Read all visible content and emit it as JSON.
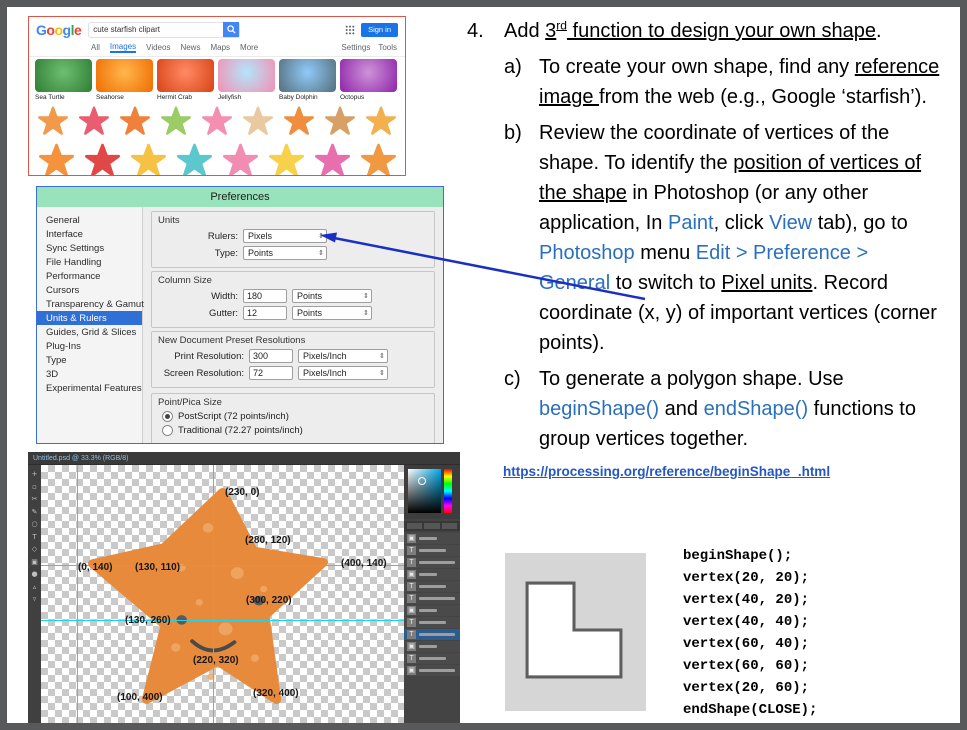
{
  "google": {
    "logo_letters": [
      {
        "ch": "G",
        "color": "#4285F4"
      },
      {
        "ch": "o",
        "color": "#EA4335"
      },
      {
        "ch": "o",
        "color": "#FBBC05"
      },
      {
        "ch": "g",
        "color": "#4285F4"
      },
      {
        "ch": "l",
        "color": "#34A853"
      },
      {
        "ch": "e",
        "color": "#EA4335"
      }
    ],
    "query": "cute starfish clipart",
    "signin": "Sign in",
    "tabs": [
      "All",
      "Images",
      "Videos",
      "News",
      "Maps",
      "More"
    ],
    "right_tabs": [
      "Settings",
      "Tools"
    ],
    "related": [
      {
        "label": "Sea Turtle",
        "colors": [
          "#6fbf73",
          "#2e7d32"
        ]
      },
      {
        "label": "Seahorse",
        "colors": [
          "#ffb74d",
          "#ef6c00"
        ]
      },
      {
        "label": "Hermit Crab",
        "colors": [
          "#ff8a65",
          "#d84315"
        ]
      },
      {
        "label": "Jellyfish",
        "colors": [
          "#b3e5fc",
          "#f48fb1"
        ]
      },
      {
        "label": "Baby Dolphin",
        "colors": [
          "#90caf9",
          "#546e7a"
        ]
      },
      {
        "label": "Octopus",
        "colors": [
          "#ce93d8",
          "#8e24aa"
        ]
      }
    ],
    "star_rows": [
      [
        "#f2994a",
        "#e85d6f",
        "#ef813c",
        "#9ccc65",
        "#f48fb1",
        "#e8c9a0",
        "#ef8e3e",
        "#d9a066",
        "#f2b04e"
      ],
      [
        "#f5923e",
        "#e04848",
        "#f6c244",
        "#5bc8ce",
        "#f08db0",
        "#f7d14b",
        "#e86fae",
        "#ef9a42"
      ]
    ]
  },
  "prefs": {
    "title": "Preferences",
    "sidebar": [
      "General",
      "Interface",
      "Sync Settings",
      "File Handling",
      "Performance",
      "Cursors",
      "Transparency & Gamut",
      "Units & Rulers",
      "Guides, Grid & Slices",
      "Plug-Ins",
      "Type",
      "3D",
      "Experimental Features"
    ],
    "active_index": 7,
    "units": {
      "title": "Units",
      "rulers_label": "Rulers:",
      "rulers_value": "Pixels",
      "type_label": "Type:",
      "type_value": "Points"
    },
    "column": {
      "title": "Column Size",
      "width_label": "Width:",
      "width_value": "180",
      "width_unit": "Points",
      "gutter_label": "Gutter:",
      "gutter_value": "12",
      "gutter_unit": "Points"
    },
    "resolutions": {
      "title": "New Document Preset Resolutions",
      "print_label": "Print Resolution:",
      "print_value": "300",
      "print_unit": "Pixels/Inch",
      "screen_label": "Screen Resolution:",
      "screen_value": "72",
      "screen_unit": "Pixels/Inch"
    },
    "pointpica": {
      "title": "Point/Pica Size",
      "options": [
        {
          "label": "PostScript (72 points/inch)",
          "selected": true
        },
        {
          "label": "Traditional (72.27 points/inch)",
          "selected": false
        }
      ]
    }
  },
  "ps": {
    "title": "Untitled.psd @ 33.3% (RGB/8)",
    "coords": [
      "(230, 0)",
      "(0, 140)",
      "(130, 110)",
      "(280, 120)",
      "(400, 140)",
      "(300, 220)",
      "(130, 260)",
      "(220, 320)",
      "(100, 400)",
      "(320, 400)"
    ],
    "starfish_color": "#e78a3c",
    "tools": [
      {
        "name": "move-tool",
        "glyph": "+"
      },
      {
        "name": "marquee-tool",
        "glyph": "▫"
      },
      {
        "name": "lasso-tool",
        "glyph": "✂"
      },
      {
        "name": "pen-tool",
        "glyph": "✎"
      },
      {
        "name": "eyedropper-tool",
        "glyph": "○"
      },
      {
        "name": "type-tool",
        "glyph": "T"
      },
      {
        "name": "shape-tool",
        "glyph": "◇"
      },
      {
        "name": "crop-tool",
        "glyph": "▣"
      },
      {
        "name": "brush-tool",
        "glyph": "●"
      },
      {
        "name": "zoom-in-tool",
        "glyph": "▵"
      },
      {
        "name": "zoom-out-tool",
        "glyph": "▿"
      }
    ],
    "layers": [
      {
        "icon": "▣"
      },
      {
        "icon": "T"
      },
      {
        "icon": "T"
      },
      {
        "icon": "▣"
      },
      {
        "icon": "T"
      },
      {
        "icon": "T"
      },
      {
        "icon": "▣"
      },
      {
        "icon": "T"
      },
      {
        "icon": "T",
        "selected": true
      },
      {
        "icon": "▣"
      },
      {
        "icon": "T"
      },
      {
        "icon": "▣"
      }
    ]
  },
  "content": {
    "number": "4.",
    "heading": [
      {
        "t": "Add "
      },
      {
        "t": "3",
        "c": "u"
      },
      {
        "t": "rd",
        "c": "u sup"
      },
      {
        "t": " function to design your own shape",
        "c": "u"
      },
      {
        "t": "."
      }
    ],
    "items": [
      {
        "letter": "a)",
        "segments": [
          {
            "t": "To create your own shape, find any "
          },
          {
            "t": "reference image ",
            "c": "u"
          },
          {
            "t": "from the web (e.g., Google ‘starfish’)."
          }
        ]
      },
      {
        "letter": "b)",
        "segments": [
          {
            "t": "Review the coordinate of vertices of the shape. To identify the "
          },
          {
            "t": "position of vertices of the shape",
            "c": "u"
          },
          {
            "t": " in Photoshop (or any other application, In "
          },
          {
            "t": "Paint",
            "c": "b"
          },
          {
            "t": ", click "
          },
          {
            "t": "View",
            "c": "b"
          },
          {
            "t": " tab), go to "
          },
          {
            "t": "Photoshop",
            "c": "b"
          },
          {
            "t": " menu "
          },
          {
            "t": "Edit > Preference > General",
            "c": "b"
          },
          {
            "t": " to switch to "
          },
          {
            "t": "Pixel units",
            "c": "u"
          },
          {
            "t": ".  Record coordinate (x, y) of important vertices (corner points)."
          }
        ]
      },
      {
        "letter": "c)",
        "segments": [
          {
            "t": "To generate a polygon shape. Use "
          },
          {
            "t": "beginShape()",
            "c": "b"
          },
          {
            "t": " and "
          },
          {
            "t": "endShape()",
            "c": "b"
          },
          {
            "t": " functions to group vertices together."
          }
        ]
      }
    ],
    "link": "https://processing.org/reference/beginShape_.html",
    "code": [
      "beginShape();",
      "vertex(20, 20);",
      "vertex(40, 20);",
      "vertex(40, 40);",
      "vertex(60, 40);",
      "vertex(60, 60);",
      "vertex(20, 60);",
      "endShape(CLOSE);"
    ]
  }
}
